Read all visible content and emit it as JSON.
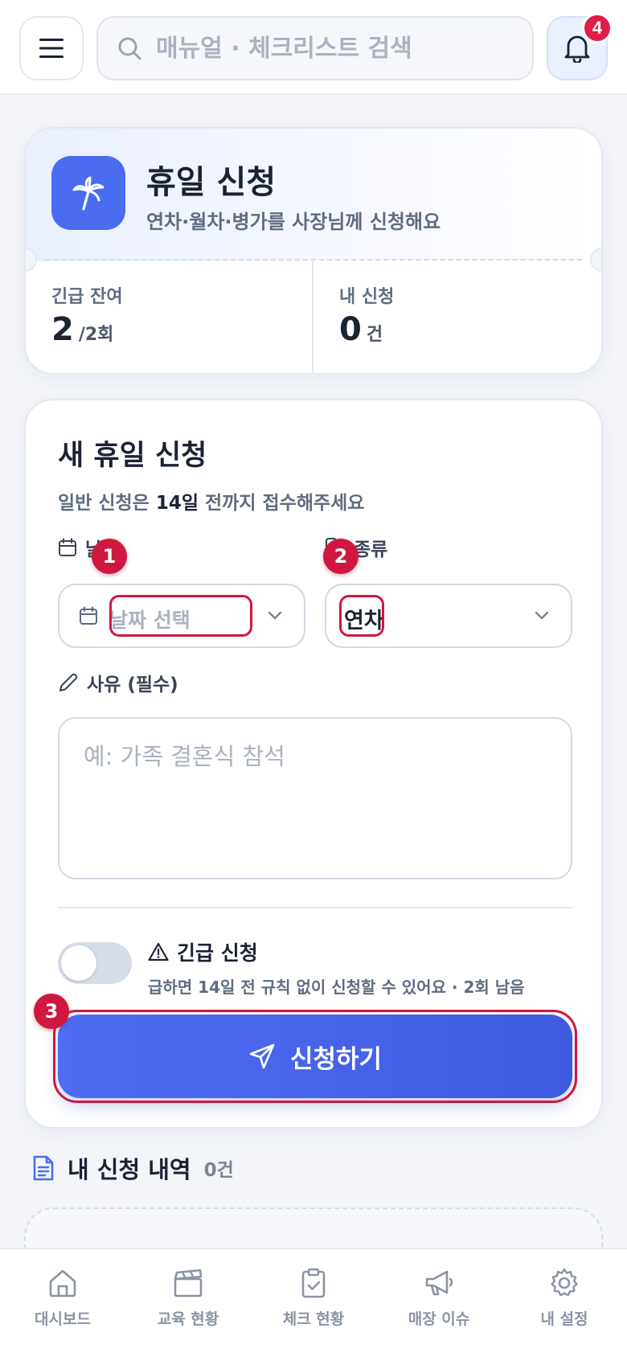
{
  "header": {
    "search_placeholder": "매뉴얼 · 체크리스트 검색",
    "notification_count": "4"
  },
  "hero": {
    "title": "휴일 신청",
    "subtitle": "연차·월차·병가를 사장님께 신청해요",
    "stats": [
      {
        "label": "긴급 잔여",
        "value": "2",
        "unit": "/2회"
      },
      {
        "label": "내 신청",
        "value": "0",
        "unit": "건"
      }
    ]
  },
  "form": {
    "title": "새 휴일 신청",
    "subtitle_pre": "일반 신청은 ",
    "subtitle_em": "14일",
    "subtitle_post": " 전까지 접수해주세요",
    "date_label": "날짜",
    "date_placeholder": "날짜 선택",
    "type_label": "종류",
    "type_value": "연차",
    "reason_label": "사유 (필수)",
    "reason_placeholder": "예: 가족 결혼식 참석",
    "urgent_title": "긴급 신청",
    "urgent_desc": "급하면 14일 전 규칙 없이 신청할 수 있어요 · 2회 남음",
    "submit_label": "신청하기"
  },
  "markers": [
    "1",
    "2",
    "3"
  ],
  "history": {
    "title": "내 신청 내역",
    "count": "0건"
  },
  "nav": [
    {
      "label": "대시보드",
      "icon": "home-icon"
    },
    {
      "label": "교육 현황",
      "icon": "clapperboard-icon"
    },
    {
      "label": "체크 현황",
      "icon": "clipboard-check-icon"
    },
    {
      "label": "매장 이슈",
      "icon": "megaphone-icon"
    },
    {
      "label": "내 설정",
      "icon": "gear-icon"
    }
  ],
  "colors": {
    "primary": "#4a6cf0",
    "highlight": "#d0173f",
    "badge": "#e11d48",
    "text": "#1b2233",
    "muted": "#5f6b80"
  }
}
